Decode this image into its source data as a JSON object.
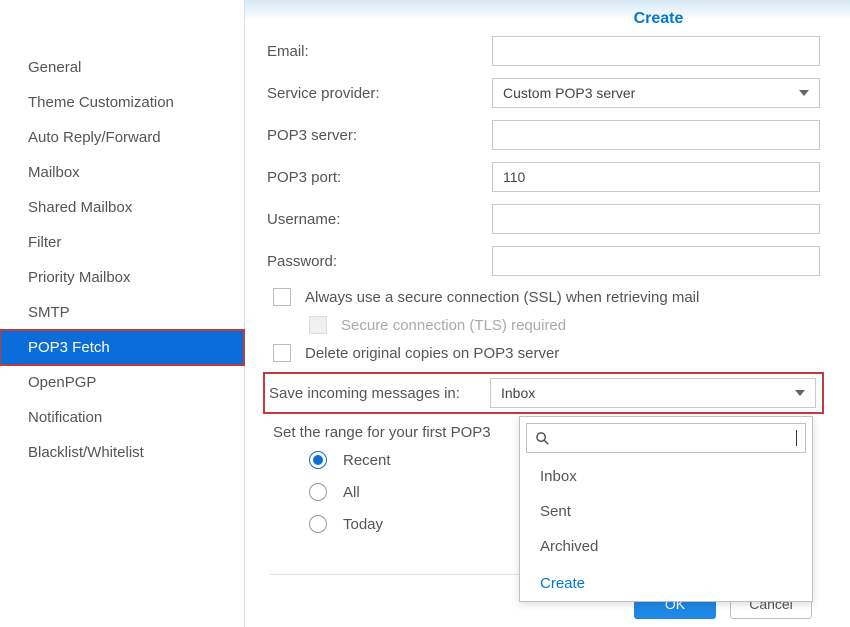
{
  "sidebar": {
    "items": [
      {
        "label": "General"
      },
      {
        "label": "Theme Customization"
      },
      {
        "label": "Auto Reply/Forward"
      },
      {
        "label": "Mailbox"
      },
      {
        "label": "Shared Mailbox"
      },
      {
        "label": "Filter"
      },
      {
        "label": "Priority Mailbox"
      },
      {
        "label": "SMTP"
      },
      {
        "label": "POP3 Fetch"
      },
      {
        "label": "OpenPGP"
      },
      {
        "label": "Notification"
      },
      {
        "label": "Blacklist/Whitelist"
      }
    ],
    "active_index": 8
  },
  "form": {
    "title": "Create",
    "email_label": "Email:",
    "email_value": "",
    "provider_label": "Service provider:",
    "provider_value": "Custom POP3 server",
    "server_label": "POP3 server:",
    "server_value": "",
    "port_label": "POP3 port:",
    "port_value": "110",
    "username_label": "Username:",
    "username_value": "",
    "password_label": "Password:",
    "password_value": "",
    "ssl_label": "Always use a secure connection (SSL) when retrieving mail",
    "tls_label": "Secure connection (TLS) required",
    "delete_label": "Delete original copies on POP3 server",
    "save_label": "Save incoming messages in:",
    "save_value": "Inbox",
    "range_label": "Set the range for your first POP3",
    "range_options": {
      "recent": "Recent",
      "all": "All",
      "today": "Today"
    }
  },
  "dropdown": {
    "search_value": "",
    "options": [
      {
        "label": "Inbox"
      },
      {
        "label": "Sent"
      },
      {
        "label": "Archived"
      }
    ],
    "create_label": "Create"
  },
  "buttons": {
    "ok": "OK",
    "cancel": "Cancel"
  }
}
